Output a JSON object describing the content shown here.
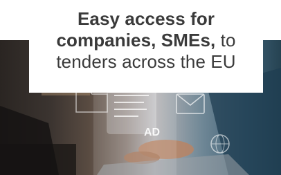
{
  "banner": {
    "line1": "Easy access for",
    "line2_bold": "companies, SMEs,",
    "line2_rest": " to",
    "line3": "tenders across the EU"
  },
  "photo": {
    "overlay_label": "AD"
  },
  "colors": {
    "text": "#3a3a3a",
    "caption_bg": "#ffffff",
    "photo_warm": "#5a4c42",
    "photo_cool": "#3d5f74"
  },
  "icons": [
    "document-icon",
    "email-icon",
    "folder-icon",
    "globe-icon"
  ]
}
